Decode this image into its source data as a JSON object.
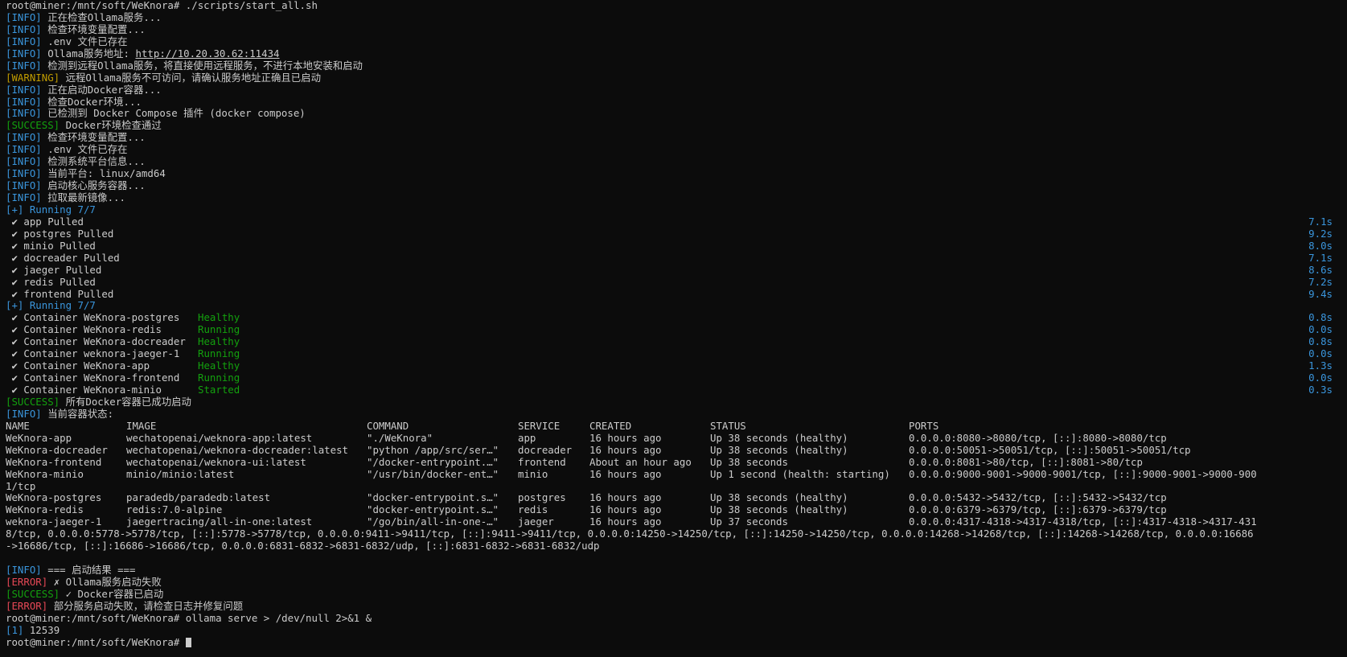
{
  "lines": {
    "l0": "root@miner:/mnt/soft/WeKnora# ./scripts/start_all.sh",
    "l1": "正在检查Ollama服务...",
    "l2": "检查环境变量配置...",
    "l3": ".env 文件已存在",
    "l4_text": "Ollama服务地址: ",
    "l4_url": "http://10.20.30.62:11434",
    "l5": "检测到远程Ollama服务，将直接使用远程服务，不进行本地安装和启动",
    "l6": "远程Ollama服务不可访问，请确认服务地址正确且已启动",
    "l7": "正在启动Docker容器...",
    "l8": "检查Docker环境...",
    "l9": "已检测到 Docker Compose 插件 (docker compose)",
    "l10": "Docker环境检查通过",
    "l11": "检查环境变量配置...",
    "l12": ".env 文件已存在",
    "l13": "检测系统平台信息...",
    "l14": "当前平台: linux/amd64",
    "l15": "启动核心服务容器...",
    "l16": "拉取最新镜像...",
    "running1": "[+] Running 7/7",
    "running2": "[+] Running 7/7",
    "success_all": "所有Docker容器已成功启动",
    "status_hdr": "当前容器状态:",
    "result_hdr": "=== 启动结果 ===",
    "err1": "✗ Ollama服务启动失败",
    "succ2": "✓ Docker容器已启动",
    "err2": "部分服务启动失败，请检查日志并修复问题",
    "cmd2": "root@miner:/mnt/soft/WeKnora# ollama serve > /dev/null 2>&1 &",
    "job_num": "[1]",
    "job_pid": " 12539",
    "prompt_final": "root@miner:/mnt/soft/WeKnora# "
  },
  "tags": {
    "info": "[INFO]",
    "warning": "[WARNING]",
    "success": "[SUCCESS]",
    "error": "[ERROR]"
  },
  "pulled": [
    {
      "text": " ✔ app Pulled",
      "time": "7.1s"
    },
    {
      "text": " ✔ postgres Pulled",
      "time": "9.2s"
    },
    {
      "text": " ✔ minio Pulled",
      "time": "8.0s"
    },
    {
      "text": " ✔ docreader Pulled",
      "time": "7.1s"
    },
    {
      "text": " ✔ jaeger Pulled",
      "time": "8.6s"
    },
    {
      "text": " ✔ redis Pulled",
      "time": "7.2s"
    },
    {
      "text": " ✔ frontend Pulled",
      "time": "9.4s"
    }
  ],
  "containers": [
    {
      "name": " ✔ Container WeKnora-postgres",
      "state": "Healthy",
      "time": "0.8s"
    },
    {
      "name": " ✔ Container WeKnora-redis",
      "state": "Running",
      "time": "0.0s"
    },
    {
      "name": " ✔ Container WeKnora-docreader",
      "state": "Healthy",
      "time": "0.8s"
    },
    {
      "name": " ✔ Container weknora-jaeger-1",
      "state": "Running",
      "time": "0.0s"
    },
    {
      "name": " ✔ Container WeKnora-app",
      "state": "Healthy",
      "time": "1.3s"
    },
    {
      "name": " ✔ Container WeKnora-frontend",
      "state": "Running",
      "time": "0.0s"
    },
    {
      "name": " ✔ Container WeKnora-minio",
      "state": "Started",
      "time": "0.3s"
    }
  ],
  "table": {
    "headers": [
      "NAME",
      "IMAGE",
      "COMMAND",
      "SERVICE",
      "CREATED",
      "STATUS",
      "PORTS"
    ],
    "rows": [
      [
        "WeKnora-app",
        "wechatopenai/weknora-app:latest",
        "\"./WeKnora\"",
        "app",
        "16 hours ago",
        "Up 38 seconds (healthy)",
        "0.0.0.0:8080->8080/tcp, [::]:8080->8080/tcp"
      ],
      [
        "WeKnora-docreader",
        "wechatopenai/weknora-docreader:latest",
        "\"python /app/src/ser…\"",
        "docreader",
        "16 hours ago",
        "Up 38 seconds (healthy)",
        "0.0.0.0:50051->50051/tcp, [::]:50051->50051/tcp"
      ],
      [
        "WeKnora-frontend",
        "wechatopenai/weknora-ui:latest",
        "\"/docker-entrypoint.…\"",
        "frontend",
        "About an hour ago",
        "Up 38 seconds",
        "0.0.0.0:8081->80/tcp, [::]:8081->80/tcp"
      ],
      [
        "WeKnora-minio",
        "minio/minio:latest",
        "\"/usr/bin/docker-ent…\"",
        "minio",
        "16 hours ago",
        "Up 1 second (health: starting)",
        "0.0.0.0:9000-9001->9000-9001/tcp, [::]:9000-9001->9000-900"
      ],
      [
        "WeKnora-postgres",
        "paradedb/paradedb:latest",
        "\"docker-entrypoint.s…\"",
        "postgres",
        "16 hours ago",
        "Up 38 seconds (healthy)",
        "0.0.0.0:5432->5432/tcp, [::]:5432->5432/tcp"
      ],
      [
        "WeKnora-redis",
        "redis:7.0-alpine",
        "\"docker-entrypoint.s…\"",
        "redis",
        "16 hours ago",
        "Up 38 seconds (healthy)",
        "0.0.0.0:6379->6379/tcp, [::]:6379->6379/tcp"
      ],
      [
        "weknora-jaeger-1",
        "jaegertracing/all-in-one:latest",
        "\"/go/bin/all-in-one-…\"",
        "jaeger",
        "16 hours ago",
        "Up 37 seconds",
        "0.0.0.0:4317-4318->4317-4318/tcp, [::]:4317-4318->4317-431"
      ]
    ],
    "minio_wrap": "1/tcp",
    "jaeger_wrap1": "8/tcp, 0.0.0.0:5778->5778/tcp, [::]:5778->5778/tcp, 0.0.0.0:9411->9411/tcp, [::]:9411->9411/tcp, 0.0.0.0:14250->14250/tcp, [::]:14250->14250/tcp, 0.0.0.0:14268->14268/tcp, [::]:14268->14268/tcp, 0.0.0.0:16686",
    "jaeger_wrap2": "->16686/tcp, [::]:16686->16686/tcp, 0.0.0.0:6831-6832->6831-6832/udp, [::]:6831-6832->6831-6832/udp"
  }
}
